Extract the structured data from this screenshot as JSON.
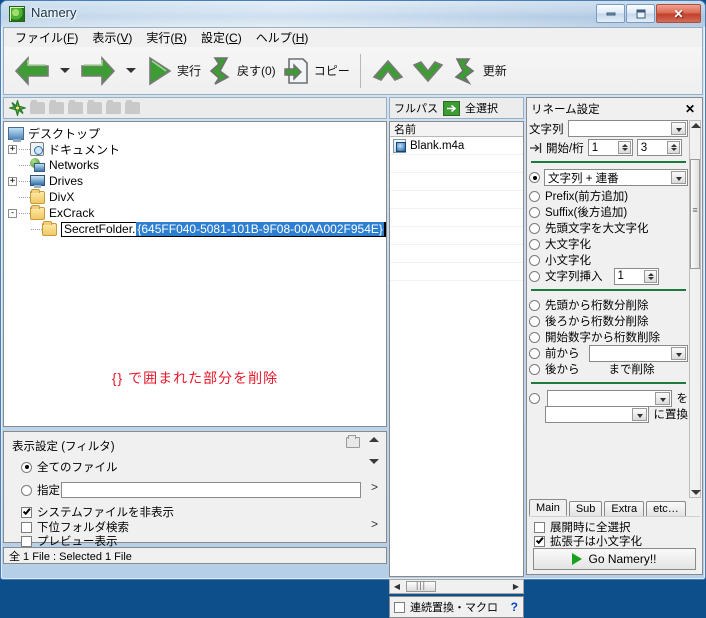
{
  "window": {
    "title": "Namery",
    "app_icon": "app-logo-icon",
    "buttons": {
      "minimize": "minimize-icon",
      "maximize": "maximize-icon",
      "close": "close-icon"
    }
  },
  "menubar": [
    {
      "label": "ファイル(F)",
      "text": "ファイル(",
      "accel": "F",
      "tail": ")"
    },
    {
      "label": "表示(V)",
      "text": "表示(",
      "accel": "V",
      "tail": ")"
    },
    {
      "label": "実行(R)",
      "text": "実行(",
      "accel": "R",
      "tail": ")"
    },
    {
      "label": "設定(C)",
      "text": "設定(",
      "accel": "C",
      "tail": ")"
    },
    {
      "label": "ヘルプ(H)",
      "text": "ヘルプ(",
      "accel": "H",
      "tail": ")"
    }
  ],
  "toolbar": {
    "back": "back-arrow-icon",
    "forward": "forward-arrow-icon",
    "run_label": "実行",
    "undo_label": "戻す(0)",
    "copy_label": "コピー",
    "up_icon": "up-chevron-icon",
    "down_icon": "down-chevron-icon",
    "refresh_label": "更新"
  },
  "tree_toolbar": {
    "star_icon": "star-icon",
    "crumb_count": 6
  },
  "tree": [
    {
      "label": "デスクトップ",
      "icon": "desktop-icon",
      "indent": 0,
      "expander": ""
    },
    {
      "label": "ドキュメント",
      "icon": "documents-icon",
      "indent": 1,
      "expander": "+"
    },
    {
      "label": "Networks",
      "icon": "network-icon",
      "indent": 1,
      "expander": ""
    },
    {
      "label": "Drives",
      "icon": "drives-icon",
      "indent": 1,
      "expander": "+"
    },
    {
      "label": "DivX",
      "icon": "folder-icon",
      "indent": 1,
      "expander": ""
    },
    {
      "label": "ExCrack",
      "icon": "folder-icon",
      "indent": 1,
      "expander": "-"
    }
  ],
  "rename_edit": {
    "icon": "folder-icon",
    "prefix_text": "SecretFolder.",
    "selected_text": "{645FF040-5081-101B-9F08-00AA002F954E}"
  },
  "annotation": {
    "text": "{} で囲まれた部分を削除",
    "color": "#e8192c"
  },
  "filter_panel": {
    "title": "表示設定 (フィルタ)",
    "folder_icon": "folder-icon",
    "scroll_up_icon": "scroll-up-icon",
    "scroll_down_icon": "scroll-down-icon",
    "all_files": {
      "label": "全てのファイル",
      "selected": true
    },
    "specified": {
      "label": "指定",
      "selected": false,
      "value": "",
      "placeholder": ""
    },
    "hide_system": {
      "label": "システムファイルを非表示",
      "checked": true
    },
    "search_sub": {
      "label": "下位フォルダ検索",
      "checked": false
    },
    "preview": {
      "label": "プレビュー表示",
      "checked": false
    },
    "expand_arrow_1": ">",
    "expand_arrow_2": ">"
  },
  "statusbar": {
    "text": "全 1 File : Selected 1 File"
  },
  "list_panel": {
    "fullpath_label": "フルパス",
    "fullpath_icon": "green-arrow-icon",
    "select_all_label": "全選択",
    "column_header": "名前",
    "rows": [
      {
        "name": "Blank.m4a",
        "icon": "audio-file-icon"
      }
    ],
    "hscroll": {
      "left_icon": "scroll-left-icon",
      "right_icon": "scroll-right-icon"
    },
    "macro": {
      "label": "連続置換・マクロ",
      "checked": false,
      "help": "?"
    }
  },
  "rename_settings": {
    "title": "リネーム設定",
    "close_icon": "close-icon",
    "string_row": {
      "label": "文字列",
      "value": "",
      "placeholder": ""
    },
    "start_row": {
      "icon": "start-digit-icon",
      "label": "開始/桁",
      "start": "1",
      "digits": "3"
    },
    "mode_combo": {
      "value": "文字列 + 連番",
      "selected": true
    },
    "options_group_1": [
      {
        "label": "Prefix(前方追加)",
        "selected": false
      },
      {
        "label": "Suffix(後方追加)",
        "selected": false
      },
      {
        "label": "先頭文字を大文字化",
        "selected": false
      },
      {
        "label": "大文字化",
        "selected": false
      },
      {
        "label": "小文字化",
        "selected": false
      }
    ],
    "insert_row": {
      "label": "文字列挿入",
      "selected": false,
      "value": "1"
    },
    "options_group_2": [
      {
        "label": "先頭から桁数分削除",
        "selected": false
      },
      {
        "label": "後ろから桁数分削除",
        "selected": false
      },
      {
        "label": "開始数字から桁数削除",
        "selected": false
      }
    ],
    "from_front": {
      "label": "前から",
      "selected": false,
      "value": ""
    },
    "from_back": {
      "label": "後から",
      "selected": false,
      "suffix": "まで削除"
    },
    "replace_row": {
      "selected": false,
      "find": "",
      "replace": "",
      "wo_label": "を",
      "to_label": "に置換"
    },
    "tabs": [
      {
        "label": "Main",
        "active": true
      },
      {
        "label": "Sub",
        "active": false
      },
      {
        "label": "Extra",
        "active": false
      },
      {
        "label": "etc…",
        "active": false
      }
    ],
    "bottom_options": [
      {
        "label": "展開時に全選択",
        "checked": false
      },
      {
        "label": "拡張子は小文字化",
        "checked": true
      }
    ],
    "go_button": {
      "label": "Go Namery!!",
      "icon": "play-icon"
    }
  },
  "colors": {
    "accent_green": "#1d7a3a",
    "selection_blue": "#2f7fd0",
    "annotation_red": "#e8192c",
    "titlebar_blue": "#b9d2e9"
  }
}
